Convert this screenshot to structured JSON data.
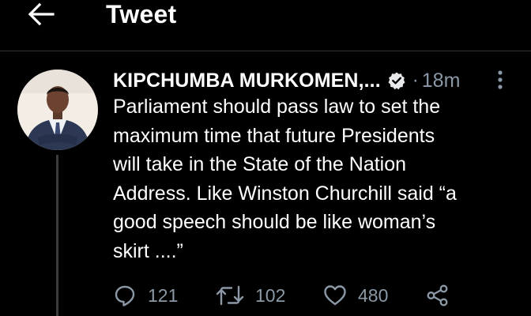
{
  "header": {
    "title": "Tweet",
    "back_icon": "arrow-left-icon"
  },
  "tweet": {
    "author_name": "KIPCHUMBA MURKOMEN,...",
    "verified_icon": "verified-badge-icon",
    "separator": "·",
    "time": "18m",
    "more_icon": "more-vertical-icon",
    "text_lines": [
      "Parliament should pass law to set the",
      "maximum time that future Presidents",
      "will take in the State of the Nation",
      "Address. Like Winston Churchill said “a",
      "good speech should be like woman’s",
      "skirt ....”"
    ],
    "actions": {
      "replies": "121",
      "retweets": "102",
      "likes": "480"
    }
  },
  "colors": {
    "background": "#000000",
    "text": "#ffffff",
    "muted": "#8b98a5",
    "divider": "#2f3336"
  }
}
